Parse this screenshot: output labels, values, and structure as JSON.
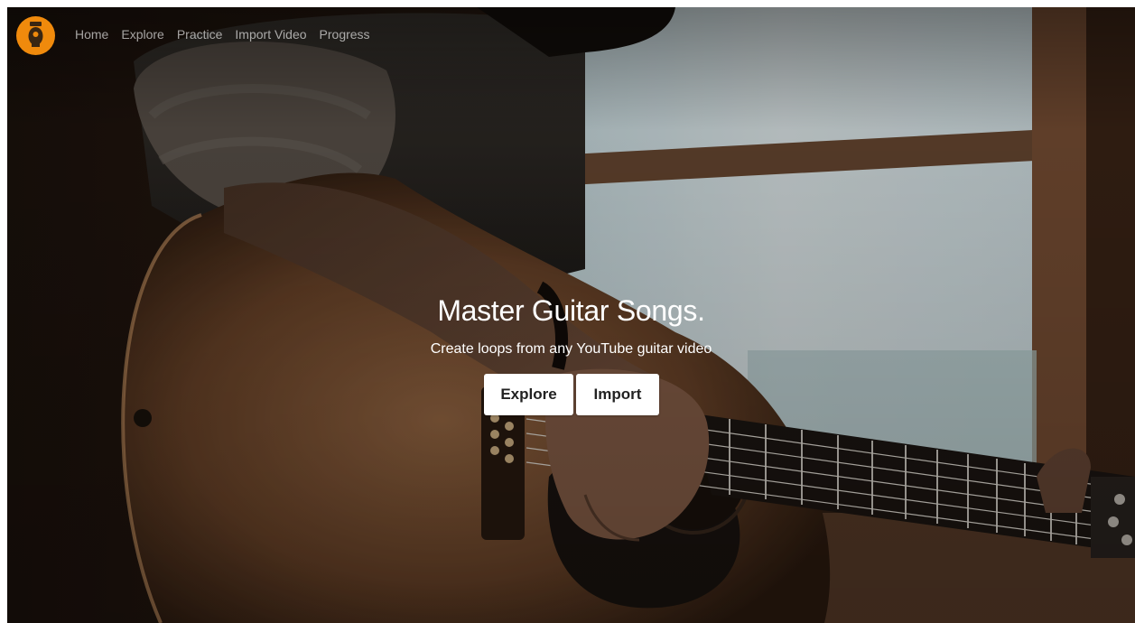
{
  "nav": {
    "logo_icon": "guitar-logo-icon",
    "links": [
      {
        "label": "Home"
      },
      {
        "label": "Explore"
      },
      {
        "label": "Practice"
      },
      {
        "label": "Import Video"
      },
      {
        "label": "Progress"
      }
    ]
  },
  "hero": {
    "title": "Master Guitar Songs.",
    "subtitle": "Create loops from any YouTube guitar video",
    "buttons": {
      "explore": "Explore",
      "import": "Import"
    }
  },
  "colors": {
    "accent": "#f08a0c",
    "button_bg": "#ffffff",
    "button_text": "#222222"
  }
}
